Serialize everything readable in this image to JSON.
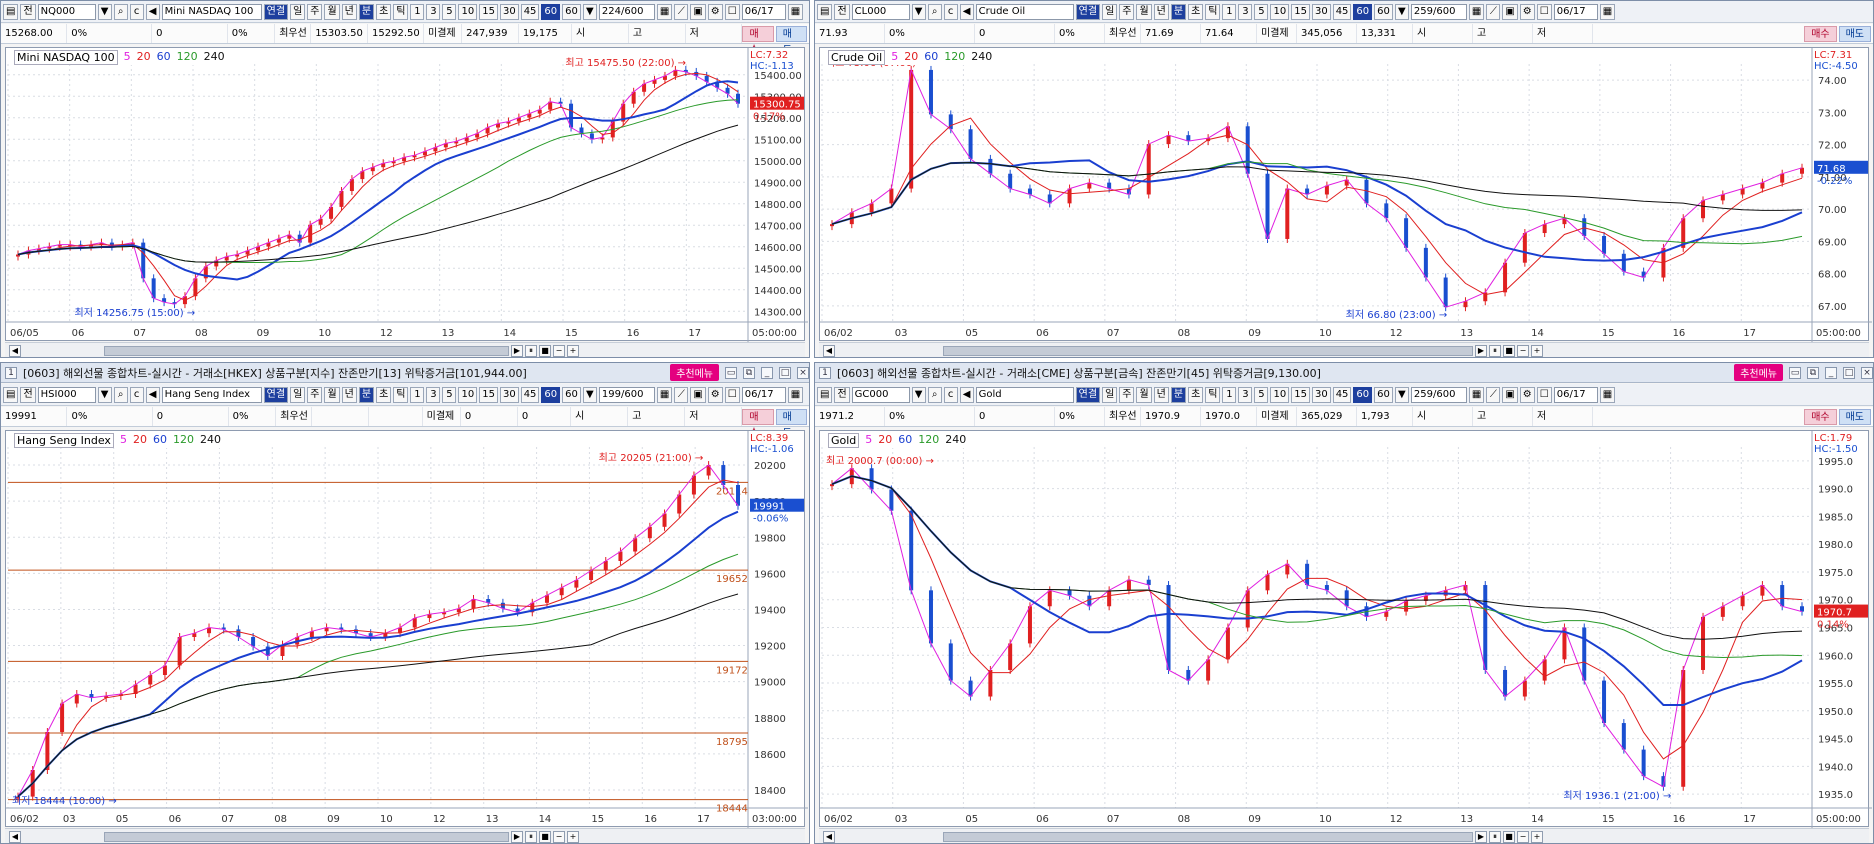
{
  "panels": [
    {
      "id": "p1",
      "title": "",
      "code": "NQ000",
      "name": "Mini NASDAQ 100",
      "count": "224",
      "count_max": "600",
      "date": "06/17",
      "price": "15268.00",
      "change_pct": "0%",
      "qty": "0",
      "qty_pct": "0%",
      "best_label": "최우선",
      "best_bid": "15303.50",
      "best_ask": "15292.50",
      "oi_label": "미결제",
      "oi": "247,939",
      "oi_chg": "19,175",
      "open_label": "시",
      "high_label": "고",
      "low_label": "저",
      "buy": "매수",
      "sell": "매도",
      "legend_name": "Mini NASDAQ 100",
      "ma": [
        "5",
        "20",
        "60",
        "120",
        "240"
      ],
      "lc": "LC:7.32",
      "hc": "HC:-1.13",
      "cur_price": "15300.75",
      "cur_pct": "0.17%",
      "y_ticks": [
        "15400.00",
        "15300.00",
        "15200.00",
        "15100.00",
        "15000.00",
        "14900.00",
        "14800.00",
        "14700.00",
        "14600.00",
        "14500.00",
        "14400.00",
        "14300.00"
      ],
      "x_labels": [
        "06/05",
        "06",
        "07",
        "08",
        "09",
        "10",
        "12",
        "13",
        "14",
        "15",
        "16",
        "17"
      ],
      "x_end": "05:00:00",
      "hi_label": "최고 15475.50 (22:00)",
      "lo_label": "최저 14256.75 (15:00)",
      "chart_data": {
        "type": "line",
        "ylim": [
          14200,
          15500
        ],
        "series": [
          {
            "name": "price",
            "values": [
              14540,
              14560,
              14570,
              14580,
              14590,
              14590,
              14580,
              14590,
              14600,
              14580,
              14590,
              14600,
              14420,
              14320,
              14300,
              14290,
              14330,
              14420,
              14480,
              14510,
              14530,
              14540,
              14560,
              14580,
              14600,
              14620,
              14640,
              14600,
              14690,
              14720,
              14780,
              14860,
              14920,
              14960,
              14980,
              15000,
              15010,
              15030,
              15040,
              15060,
              15080,
              15100,
              15110,
              15130,
              15150,
              15180,
              15200,
              15210,
              15230,
              15250,
              15270,
              15310,
              15300,
              15180,
              15150,
              15120,
              15130,
              15210,
              15300,
              15360,
              15400,
              15420,
              15440,
              15470,
              15460,
              15440,
              15410,
              15380,
              15350,
              15300
            ]
          }
        ]
      }
    },
    {
      "id": "p2",
      "title": "",
      "code": "CL000",
      "name": "Crude Oil",
      "count": "259",
      "count_max": "600",
      "date": "06/17",
      "price": "71.93",
      "change_pct": "0%",
      "qty": "0",
      "qty_pct": "0%",
      "best_label": "최우선",
      "best_bid": "71.69",
      "best_ask": "71.64",
      "oi_label": "미결제",
      "oi": "345,056",
      "oi_chg": "13,331",
      "open_label": "시",
      "high_label": "고",
      "low_label": "저",
      "buy": "매수",
      "sell": "매도",
      "legend_name": "Crude Oil",
      "ma": [
        "5",
        "20",
        "60",
        "120",
        "240"
      ],
      "lc": "LC:7.31",
      "hc": "HC:-4.50",
      "cur_price": "71.68",
      "cur_pct": "-0.22%",
      "y_ticks": [
        "74.00",
        "73.00",
        "72.00",
        "71.00",
        "70.00",
        "69.00",
        "68.00",
        "67.00"
      ],
      "x_labels": [
        "06/02",
        "03",
        "05",
        "06",
        "07",
        "08",
        "09",
        "10",
        "12",
        "13",
        "14",
        "15",
        "16",
        "17"
      ],
      "x_end": "05:00:00",
      "hi_label": "최고 75.06 (07:00)",
      "lo_label": "최저 66.80 (23:00)",
      "chart_data": {
        "type": "line",
        "ylim": [
          66.5,
          75.2
        ],
        "series": [
          {
            "name": "price",
            "values": [
              69.8,
              70.2,
              70.5,
              71.0,
              75.0,
              73.5,
              73.0,
              72.0,
              71.5,
              71.0,
              70.8,
              70.5,
              71.0,
              71.2,
              71.0,
              70.8,
              72.5,
              72.8,
              72.6,
              72.7,
              73.1,
              71.5,
              69.3,
              71.0,
              70.8,
              71.1,
              71.3,
              70.5,
              70.0,
              69.0,
              68.0,
              67.0,
              67.2,
              67.5,
              68.5,
              69.5,
              69.8,
              70.0,
              69.4,
              68.8,
              68.2,
              68.0,
              69.0,
              70.0,
              70.6,
              70.8,
              71.0,
              71.2,
              71.5,
              71.7
            ]
          }
        ]
      }
    },
    {
      "id": "p3",
      "title": "[0603] 해외선물 종합차트-실시간 - 거래소[HKEX] 상품구분[지수] 잔존만기[13] 위탁증거금[101,944.00]",
      "code": "HSI000",
      "name": "Hang Seng Index",
      "count": "199",
      "count_max": "600",
      "date": "06/17",
      "price": "19991",
      "change_pct": "0%",
      "qty": "0",
      "qty_pct": "0%",
      "best_label": "최우선",
      "best_bid": "",
      "best_ask": "",
      "oi_label": "미결제",
      "oi": "0",
      "oi_chg": "0",
      "open_label": "시",
      "high_label": "고",
      "low_label": "저",
      "buy": "매수",
      "sell": "매도",
      "legend_name": "Hang Seng Index",
      "ma": [
        "5",
        "20",
        "60",
        "120",
        "240"
      ],
      "lc": "LC:8.39",
      "hc": "HC:-1.06",
      "cur_price": "19991",
      "cur_pct": "-0.06%",
      "y_ticks": [
        "20200",
        "20000",
        "19800",
        "19600",
        "19400",
        "19200",
        "19000",
        "18800",
        "18600",
        "18400"
      ],
      "levels": [
        "20114",
        "19652",
        "19172",
        "18795",
        "18444"
      ],
      "x_labels": [
        "06/02",
        "03",
        "05",
        "06",
        "07",
        "08",
        "09",
        "10",
        "12",
        "13",
        "14",
        "15",
        "16",
        "17"
      ],
      "x_end": "03:00:00",
      "hi_label": "최고 20205 (21:00)",
      "lo_label": "최저 18444 (10:00)",
      "chart_data": {
        "type": "line",
        "ylim": [
          18400,
          20300
        ],
        "series": [
          {
            "name": "price",
            "values": [
              18460,
              18600,
              18800,
              18950,
              19000,
              18980,
              18990,
              19000,
              19050,
              19100,
              19150,
              19300,
              19320,
              19350,
              19340,
              19300,
              19250,
              19200,
              19260,
              19300,
              19330,
              19350,
              19340,
              19320,
              19300,
              19320,
              19350,
              19400,
              19420,
              19430,
              19450,
              19500,
              19480,
              19450,
              19430,
              19480,
              19520,
              19560,
              19600,
              19650,
              19700,
              19750,
              19820,
              19880,
              19950,
              20050,
              20150,
              20205,
              20100,
              19991
            ]
          }
        ]
      }
    },
    {
      "id": "p4",
      "title": "[0603] 해외선물 종합차트-실시간 - 거래소[CME] 상품구분[금속] 잔존만기[45] 위탁증거금[9,130.00]",
      "code": "GC000",
      "name": "Gold",
      "count": "259",
      "count_max": "600",
      "date": "06/17",
      "price": "1971.2",
      "change_pct": "0%",
      "qty": "0",
      "qty_pct": "0%",
      "best_label": "최우선",
      "best_bid": "1970.9",
      "best_ask": "1970.0",
      "oi_label": "미결제",
      "oi": "365,029",
      "oi_chg": "1,793",
      "open_label": "시",
      "high_label": "고",
      "low_label": "저",
      "buy": "매수",
      "sell": "매도",
      "legend_name": "Gold",
      "ma": [
        "5",
        "20",
        "60",
        "120",
        "240"
      ],
      "lc": "LC:1.79",
      "hc": "HC:-1.50",
      "cur_price": "1970.7",
      "cur_pct": "0.14%",
      "y_ticks": [
        "1995.0",
        "1990.0",
        "1985.0",
        "1980.0",
        "1975.0",
        "1970.0",
        "1965.0",
        "1960.0",
        "1955.0",
        "1950.0",
        "1945.0",
        "1940.0",
        "1935.0"
      ],
      "x_labels": [
        "06/02",
        "03",
        "05",
        "06",
        "07",
        "08",
        "09",
        "10",
        "12",
        "13",
        "14",
        "15",
        "16",
        "17"
      ],
      "x_end": "05:00:00",
      "hi_label": "최고 2000.7 (00:00)",
      "lo_label": "최저 1936.1 (21:00)",
      "chart_data": {
        "type": "line",
        "ylim": [
          1934,
          2002
        ],
        "series": [
          {
            "name": "price",
            "values": [
              1995,
              1998,
              1994,
              1990,
              1975,
              1965,
              1958,
              1955,
              1960,
              1965,
              1972,
              1975,
              1974,
              1972,
              1975,
              1977,
              1976,
              1960,
              1958,
              1962,
              1968,
              1975,
              1978,
              1980,
              1976,
              1975,
              1972,
              1970,
              1971,
              1973,
              1974,
              1975,
              1976,
              1960,
              1955,
              1958,
              1962,
              1968,
              1958,
              1950,
              1945,
              1940,
              1938,
              1960,
              1970,
              1972,
              1974,
              1976,
              1972,
              1971
            ]
          }
        ]
      }
    }
  ]
}
